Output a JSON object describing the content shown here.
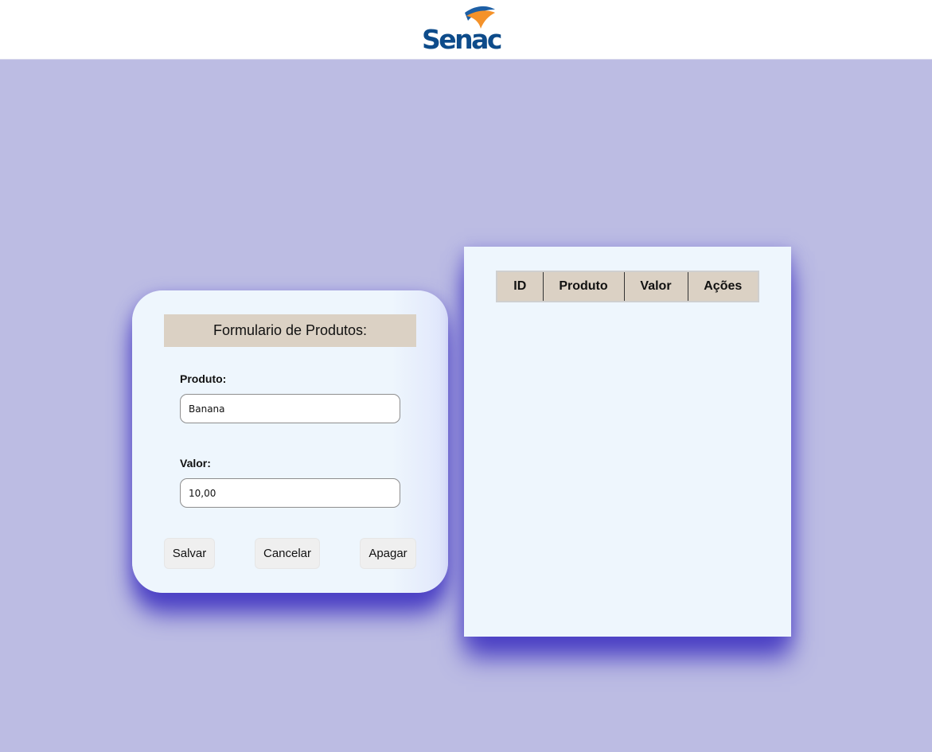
{
  "header": {
    "logo_text": "Senac",
    "logo_colors": {
      "text": "#0d4b8a",
      "sail_orange": "#f4922a",
      "sail_blue": "#1d5fa5"
    }
  },
  "form": {
    "title": "Formulario de Produtos:",
    "produto_label": "Produto:",
    "produto_value": "Banana",
    "valor_label": "Valor:",
    "valor_value": "10,00",
    "buttons": {
      "salvar": "Salvar",
      "cancelar": "Cancelar",
      "apagar": "Apagar"
    }
  },
  "table": {
    "headers": [
      "ID",
      "Produto",
      "Valor",
      "Ações"
    ],
    "rows": []
  },
  "colors": {
    "page_background": "#bcbce3",
    "card_background": "#eef6fd",
    "header_fill": "#dbd1c4",
    "shadow": "#4b40c4"
  }
}
